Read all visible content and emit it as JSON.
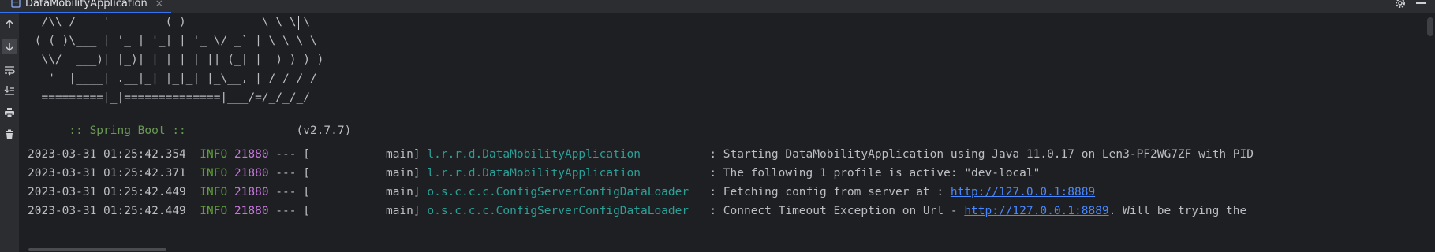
{
  "tab": {
    "title": "DataMobilityApplication",
    "close": "×"
  },
  "banner": [
    "  /\\\\ / ___'_ __ _ _(_)_ __  __ _ \\ \\ \\ \\",
    " ( ( )\\___ | '_ | '_| | '_ \\/ _` | \\ \\ \\ \\",
    "  \\\\/  ___)| |_)| | | | | || (_| |  ) ) ) )",
    "   '  |____| .__|_| |_|_| |_\\__, | / / / /",
    "  =========|_|==============|___/=/_/_/_/"
  ],
  "spring": {
    "label": "  :: Spring Boot ::",
    "version": "(v2.7.7)"
  },
  "logs": [
    {
      "ts": "2023-03-31 01:25:42.354",
      "level": "INFO",
      "pid": "21880",
      "thread_pre": " --- [",
      "thread": "           main] ",
      "logger": "l.r.r.d.DataMobilityApplication",
      "pad": "          ",
      "msg": ": Starting DataMobilityApplication using Java 11.0.17 on Len3-PF2WG7ZF with PID"
    },
    {
      "ts": "2023-03-31 01:25:42.371",
      "level": "INFO",
      "pid": "21880",
      "thread_pre": " --- [",
      "thread": "           main] ",
      "logger": "l.r.r.d.DataMobilityApplication",
      "pad": "          ",
      "msg": ": The following 1 profile is active: \"dev-local\""
    },
    {
      "ts": "2023-03-31 01:25:42.449",
      "level": "INFO",
      "pid": "21880",
      "thread_pre": " --- [",
      "thread": "           main] ",
      "logger": "o.s.c.c.c.ConfigServerConfigDataLoader",
      "pad": "   ",
      "msg": ": Fetching config from server at : ",
      "link": "http://127.0.0.1:8889",
      "after": ""
    },
    {
      "ts": "2023-03-31 01:25:42.449",
      "level": "INFO",
      "pid": "21880",
      "thread_pre": " --- [",
      "thread": "           main] ",
      "logger": "o.s.c.c.c.ConfigServerConfigDataLoader",
      "pad": "   ",
      "msg": ": Connect Timeout Exception on Url - ",
      "link": "http://127.0.0.1:8889",
      "after": ". Will be trying the"
    }
  ]
}
